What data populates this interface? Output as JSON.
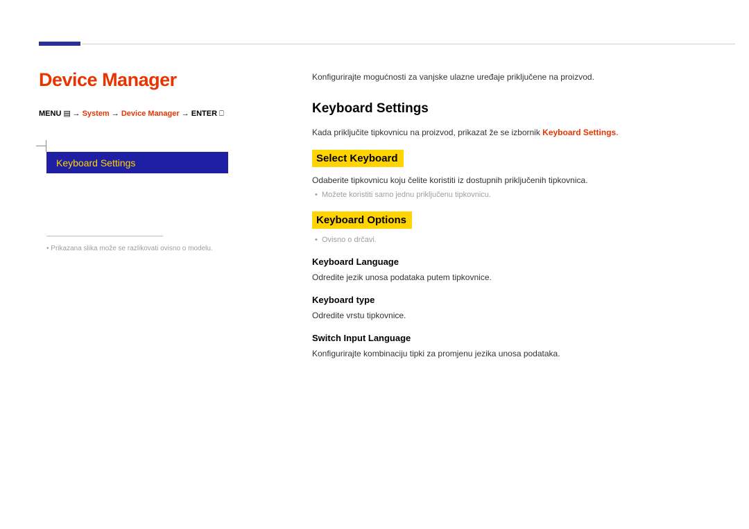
{
  "header": {
    "page_title": "Device Manager",
    "breadcrumb": {
      "menu_label": "MENU",
      "system_label": "System",
      "device_manager_label": "Device Manager",
      "enter_label": "ENTER"
    }
  },
  "sidebar": {
    "selected_item": "Keyboard Settings",
    "footnote": "Prikazana slika može se razlikovati ovisno o modelu."
  },
  "content": {
    "intro": "Konfigurirajte mogućnosti za vanjske ulazne uređaje priključene na proizvod.",
    "section1": {
      "title": "Keyboard Settings",
      "hint_pre": "Kada priključite tipkovnicu na proizvod, prikazat že se izbornik ",
      "hint_highlight": "Keyboard Settings",
      "hint_post": "."
    },
    "select_keyboard": {
      "title": "Select Keyboard",
      "desc": "Odaberite tipkovnicu koju čelite koristiti iz dostupnih priključenih tipkovnica.",
      "bullet": "Možete koristiti samo jednu priključenu tipkovnicu."
    },
    "keyboard_options": {
      "title": "Keyboard Options",
      "bullet": "Ovisno o drčavi.",
      "language": {
        "title": "Keyboard Language",
        "desc": "Odredite jezik unosa podataka putem tipkovnice."
      },
      "type": {
        "title": "Keyboard type",
        "desc": "Odredite vrstu tipkovnice."
      },
      "switch_input": {
        "title": "Switch Input Language",
        "desc": "Konfigurirajte kombinaciju tipki za promjenu jezika unosa podataka."
      }
    }
  }
}
